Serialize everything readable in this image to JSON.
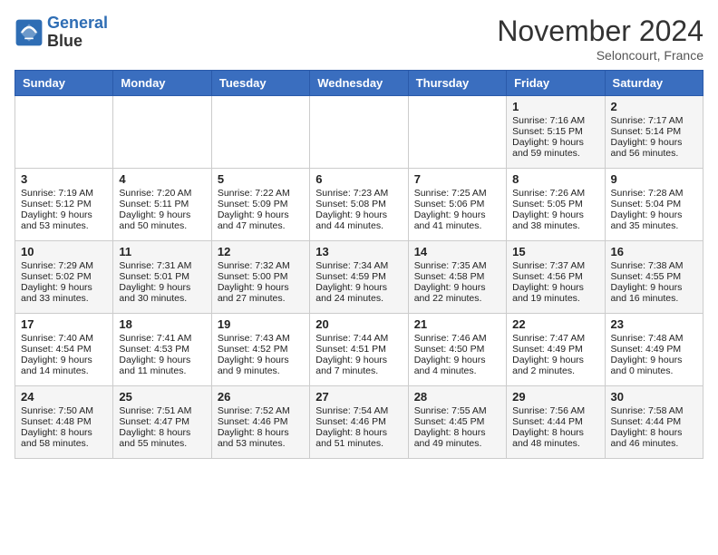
{
  "header": {
    "logo_line1": "General",
    "logo_line2": "Blue",
    "month_title": "November 2024",
    "subtitle": "Seloncourt, France"
  },
  "days_of_week": [
    "Sunday",
    "Monday",
    "Tuesday",
    "Wednesday",
    "Thursday",
    "Friday",
    "Saturday"
  ],
  "weeks": [
    [
      {
        "day": "",
        "content": ""
      },
      {
        "day": "",
        "content": ""
      },
      {
        "day": "",
        "content": ""
      },
      {
        "day": "",
        "content": ""
      },
      {
        "day": "",
        "content": ""
      },
      {
        "day": "1",
        "content": "Sunrise: 7:16 AM\nSunset: 5:15 PM\nDaylight: 9 hours and 59 minutes."
      },
      {
        "day": "2",
        "content": "Sunrise: 7:17 AM\nSunset: 5:14 PM\nDaylight: 9 hours and 56 minutes."
      }
    ],
    [
      {
        "day": "3",
        "content": "Sunrise: 7:19 AM\nSunset: 5:12 PM\nDaylight: 9 hours and 53 minutes."
      },
      {
        "day": "4",
        "content": "Sunrise: 7:20 AM\nSunset: 5:11 PM\nDaylight: 9 hours and 50 minutes."
      },
      {
        "day": "5",
        "content": "Sunrise: 7:22 AM\nSunset: 5:09 PM\nDaylight: 9 hours and 47 minutes."
      },
      {
        "day": "6",
        "content": "Sunrise: 7:23 AM\nSunset: 5:08 PM\nDaylight: 9 hours and 44 minutes."
      },
      {
        "day": "7",
        "content": "Sunrise: 7:25 AM\nSunset: 5:06 PM\nDaylight: 9 hours and 41 minutes."
      },
      {
        "day": "8",
        "content": "Sunrise: 7:26 AM\nSunset: 5:05 PM\nDaylight: 9 hours and 38 minutes."
      },
      {
        "day": "9",
        "content": "Sunrise: 7:28 AM\nSunset: 5:04 PM\nDaylight: 9 hours and 35 minutes."
      }
    ],
    [
      {
        "day": "10",
        "content": "Sunrise: 7:29 AM\nSunset: 5:02 PM\nDaylight: 9 hours and 33 minutes."
      },
      {
        "day": "11",
        "content": "Sunrise: 7:31 AM\nSunset: 5:01 PM\nDaylight: 9 hours and 30 minutes."
      },
      {
        "day": "12",
        "content": "Sunrise: 7:32 AM\nSunset: 5:00 PM\nDaylight: 9 hours and 27 minutes."
      },
      {
        "day": "13",
        "content": "Sunrise: 7:34 AM\nSunset: 4:59 PM\nDaylight: 9 hours and 24 minutes."
      },
      {
        "day": "14",
        "content": "Sunrise: 7:35 AM\nSunset: 4:58 PM\nDaylight: 9 hours and 22 minutes."
      },
      {
        "day": "15",
        "content": "Sunrise: 7:37 AM\nSunset: 4:56 PM\nDaylight: 9 hours and 19 minutes."
      },
      {
        "day": "16",
        "content": "Sunrise: 7:38 AM\nSunset: 4:55 PM\nDaylight: 9 hours and 16 minutes."
      }
    ],
    [
      {
        "day": "17",
        "content": "Sunrise: 7:40 AM\nSunset: 4:54 PM\nDaylight: 9 hours and 14 minutes."
      },
      {
        "day": "18",
        "content": "Sunrise: 7:41 AM\nSunset: 4:53 PM\nDaylight: 9 hours and 11 minutes."
      },
      {
        "day": "19",
        "content": "Sunrise: 7:43 AM\nSunset: 4:52 PM\nDaylight: 9 hours and 9 minutes."
      },
      {
        "day": "20",
        "content": "Sunrise: 7:44 AM\nSunset: 4:51 PM\nDaylight: 9 hours and 7 minutes."
      },
      {
        "day": "21",
        "content": "Sunrise: 7:46 AM\nSunset: 4:50 PM\nDaylight: 9 hours and 4 minutes."
      },
      {
        "day": "22",
        "content": "Sunrise: 7:47 AM\nSunset: 4:49 PM\nDaylight: 9 hours and 2 minutes."
      },
      {
        "day": "23",
        "content": "Sunrise: 7:48 AM\nSunset: 4:49 PM\nDaylight: 9 hours and 0 minutes."
      }
    ],
    [
      {
        "day": "24",
        "content": "Sunrise: 7:50 AM\nSunset: 4:48 PM\nDaylight: 8 hours and 58 minutes."
      },
      {
        "day": "25",
        "content": "Sunrise: 7:51 AM\nSunset: 4:47 PM\nDaylight: 8 hours and 55 minutes."
      },
      {
        "day": "26",
        "content": "Sunrise: 7:52 AM\nSunset: 4:46 PM\nDaylight: 8 hours and 53 minutes."
      },
      {
        "day": "27",
        "content": "Sunrise: 7:54 AM\nSunset: 4:46 PM\nDaylight: 8 hours and 51 minutes."
      },
      {
        "day": "28",
        "content": "Sunrise: 7:55 AM\nSunset: 4:45 PM\nDaylight: 8 hours and 49 minutes."
      },
      {
        "day": "29",
        "content": "Sunrise: 7:56 AM\nSunset: 4:44 PM\nDaylight: 8 hours and 48 minutes."
      },
      {
        "day": "30",
        "content": "Sunrise: 7:58 AM\nSunset: 4:44 PM\nDaylight: 8 hours and 46 minutes."
      }
    ]
  ]
}
